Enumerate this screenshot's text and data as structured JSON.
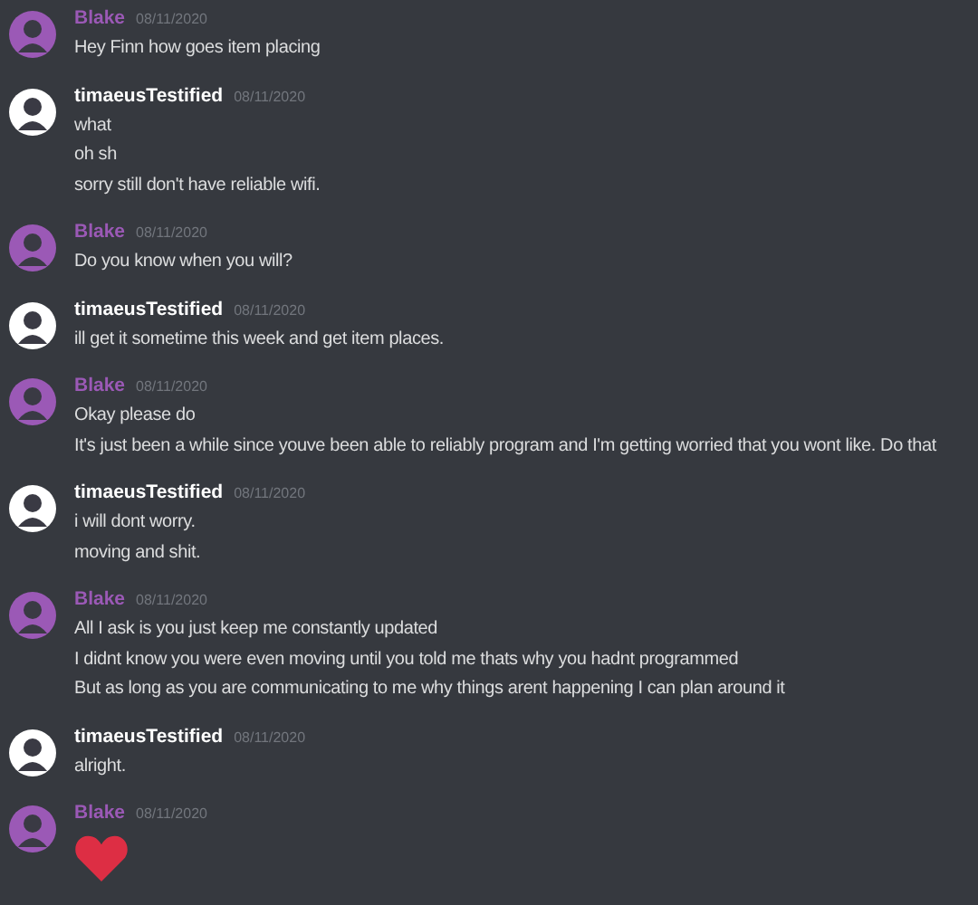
{
  "messages": [
    {
      "author": "Blake",
      "color": "#9b59b6",
      "date": "08/11/2020",
      "lines": [
        {
          "kind": "text",
          "text": "Hey Finn how goes item placing"
        }
      ]
    },
    {
      "author": "timaeusTestified",
      "color": "#ffffff",
      "date": "08/11/2020",
      "lines": [
        {
          "kind": "text",
          "text": "what"
        },
        {
          "kind": "text",
          "text": "oh sh"
        },
        {
          "kind": "text",
          "text": "sorry still don't have reliable wifi."
        }
      ]
    },
    {
      "author": "Blake",
      "color": "#9b59b6",
      "date": "08/11/2020",
      "lines": [
        {
          "kind": "text",
          "text": "Do you know when you will?"
        }
      ]
    },
    {
      "author": "timaeusTestified",
      "color": "#ffffff",
      "date": "08/11/2020",
      "lines": [
        {
          "kind": "text",
          "text": "ill get it sometime this week and get item places."
        }
      ]
    },
    {
      "author": "Blake",
      "color": "#9b59b6",
      "date": "08/11/2020",
      "lines": [
        {
          "kind": "text",
          "text": "Okay please do"
        },
        {
          "kind": "text",
          "text": "It's just been a while since youve been able to reliably program and I'm getting worried that you wont like. Do that"
        }
      ]
    },
    {
      "author": "timaeusTestified",
      "color": "#ffffff",
      "date": "08/11/2020",
      "lines": [
        {
          "kind": "text",
          "text": "i will dont worry."
        },
        {
          "kind": "text",
          "text": "moving and shit."
        }
      ]
    },
    {
      "author": "Blake",
      "color": "#9b59b6",
      "date": "08/11/2020",
      "lines": [
        {
          "kind": "text",
          "text": "All I ask is you just keep me constantly updated"
        },
        {
          "kind": "text",
          "text": "I didnt know you were even moving until you told me thats why you hadnt programmed"
        },
        {
          "kind": "text",
          "text": "But as long as you are communicating to me why things arent happening I can plan around it"
        }
      ]
    },
    {
      "author": "timaeusTestified",
      "color": "#ffffff",
      "date": "08/11/2020",
      "lines": [
        {
          "kind": "text",
          "text": "alright."
        }
      ]
    },
    {
      "author": "Blake",
      "color": "#9b59b6",
      "date": "08/11/2020",
      "lines": [
        {
          "kind": "heart"
        }
      ]
    }
  ]
}
